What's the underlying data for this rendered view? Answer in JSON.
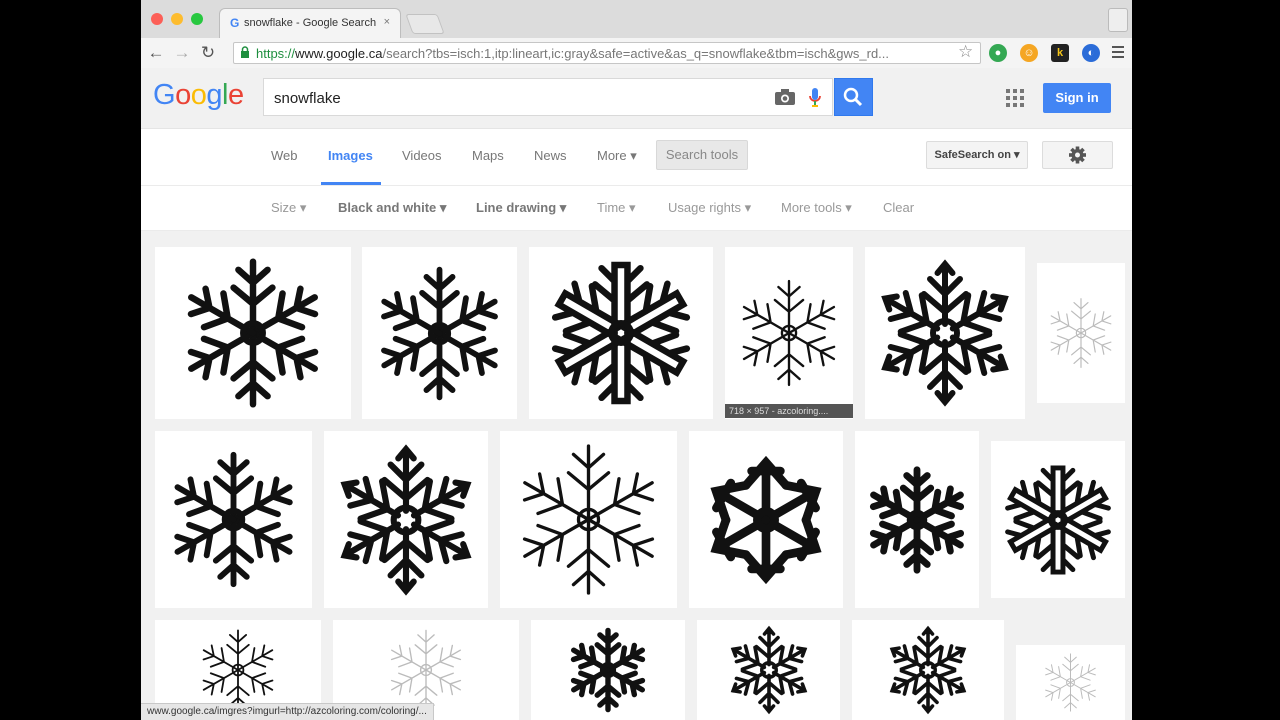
{
  "browser": {
    "tab_title": "snowflake - Google Search",
    "tab_close": "×",
    "url_scheme": "https://",
    "url_host": "www.google.ca",
    "url_rest": "/search?tbs=isch:1,itp:lineart,ic:gray&safe=active&as_q=snowflake&tbm=isch&gws_rd...",
    "status_url": "www.google.ca/imgres?imgurl=http://azcoloring.com/coloring/..."
  },
  "header": {
    "logo": [
      "G",
      "o",
      "o",
      "g",
      "l",
      "e"
    ],
    "logo_colors": [
      "#4285f4",
      "#ea4335",
      "#fbbc05",
      "#4285f4",
      "#34a853",
      "#ea4335"
    ],
    "search_value": "snowflake",
    "signin_label": "Sign in"
  },
  "nav": {
    "tabs": [
      "Web",
      "Images",
      "Videos",
      "Maps",
      "News",
      "More ▾"
    ],
    "active_tab": "Images",
    "search_tools_label": "Search tools",
    "safesearch_label": "SafeSearch on ▾"
  },
  "tools": {
    "items": [
      "Size ▾",
      "Black and white ▾",
      "Line drawing ▾",
      "Time ▾",
      "Usage rights ▾",
      "More tools ▾",
      "Clear"
    ]
  },
  "results": {
    "hover_caption": "718 × 957 - azcoloring...."
  },
  "colors": {
    "accent": "#4285f4",
    "secure_green": "#1e8e3e"
  }
}
